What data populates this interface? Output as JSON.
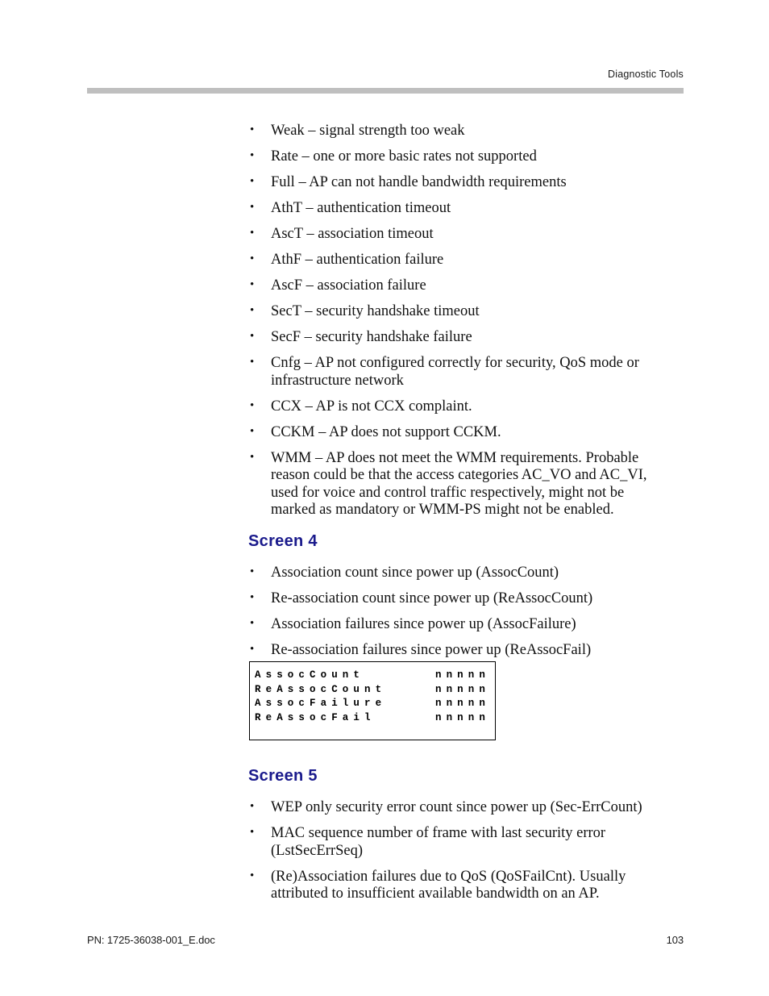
{
  "header": {
    "title": "Diagnostic Tools"
  },
  "footer": {
    "document_id": "PN: 1725-36038-001_E.doc",
    "page_number": "103"
  },
  "colors": {
    "heading_blue": "#1a1a8c",
    "header_rule_gray": "#bfbfbf",
    "body_text": "#111111"
  },
  "intro_bullets": [
    "Weak – signal strength too weak",
    "Rate – one or more basic rates not supported",
    "Full – AP can not handle bandwidth requirements",
    "AthT – authentication timeout",
    "AscT – association timeout",
    "AthF – authentication failure",
    "AscF – association failure",
    "SecT – security handshake timeout",
    "SecF – security handshake failure",
    "Cnfg – AP not configured correctly for security, QoS mode or infrastructure network",
    "CCX – AP is not CCX complaint.",
    "CCKM – AP does not support CCKM.",
    "WMM – AP does not meet the WMM requirements. Probable reason could be that the access categories AC_VO and AC_VI, used for voice and control traffic respectively, might not be marked as mandatory or WMM-PS might not be enabled."
  ],
  "screen4": {
    "heading": "Screen 4",
    "bullets": [
      "Association count since power up (AssocCount)",
      "Re-association count since power up (ReAssocCount)",
      "Association failures since power up (AssocFailure)",
      "Re-association failures since power up (ReAssocFail)"
    ],
    "display": {
      "rows": [
        {
          "label": "AssocCount",
          "value": "nnnnn"
        },
        {
          "label": "ReAssocCount",
          "value": "nnnnn"
        },
        {
          "label": "AssocFailure",
          "value": "nnnnn"
        },
        {
          "label": "ReAssocFail",
          "value": "nnnnn"
        }
      ]
    }
  },
  "screen5": {
    "heading": "Screen 5",
    "bullets": [
      "WEP only security error count since power up (Sec-ErrCount)",
      "MAC sequence number of frame with last security error (LstSecErrSeq)",
      "(Re)Association failures due to QoS (QoSFailCnt).  Usually attributed to insufficient available bandwidth on an AP."
    ]
  }
}
